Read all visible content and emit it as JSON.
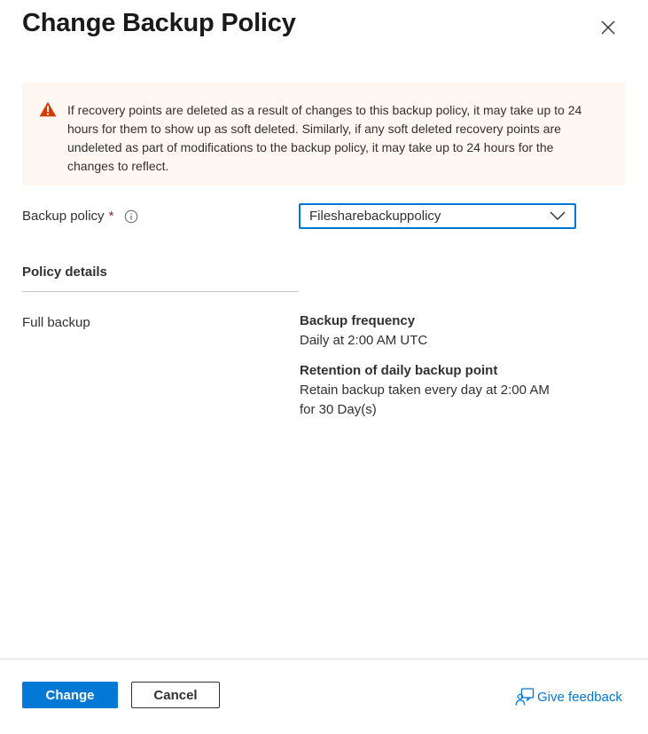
{
  "dialog": {
    "title": "Change Backup Policy"
  },
  "warning": {
    "text": "If recovery points are deleted as a result of changes to this backup policy, it may take up to 24 hours for them to show up as soft deleted. Similarly, if any soft deleted recovery points are undeleted as part of modifications to the backup policy, it may take up to 24 hours for the changes to reflect.",
    "icon": "warning-icon",
    "color": "#d83b01",
    "background": "#fff7f1"
  },
  "backup_policy": {
    "label": "Backup policy",
    "required_marker": "*",
    "selected": "Filesharebackuppolicy"
  },
  "policy_details": {
    "section_title": "Policy details",
    "row_label": "Full backup",
    "frequency_heading": "Backup frequency",
    "frequency_value": "Daily at 2:00 AM UTC",
    "retention_heading": "Retention of daily backup point",
    "retention_line1": "Retain backup taken every day at 2:00 AM",
    "retention_line2": "for 30 Day(s)"
  },
  "footer": {
    "primary_label": "Change",
    "secondary_label": "Cancel",
    "feedback_label": "Give feedback"
  },
  "colors": {
    "accent": "#0078d4",
    "required": "#a4262c",
    "text": "#323130"
  }
}
